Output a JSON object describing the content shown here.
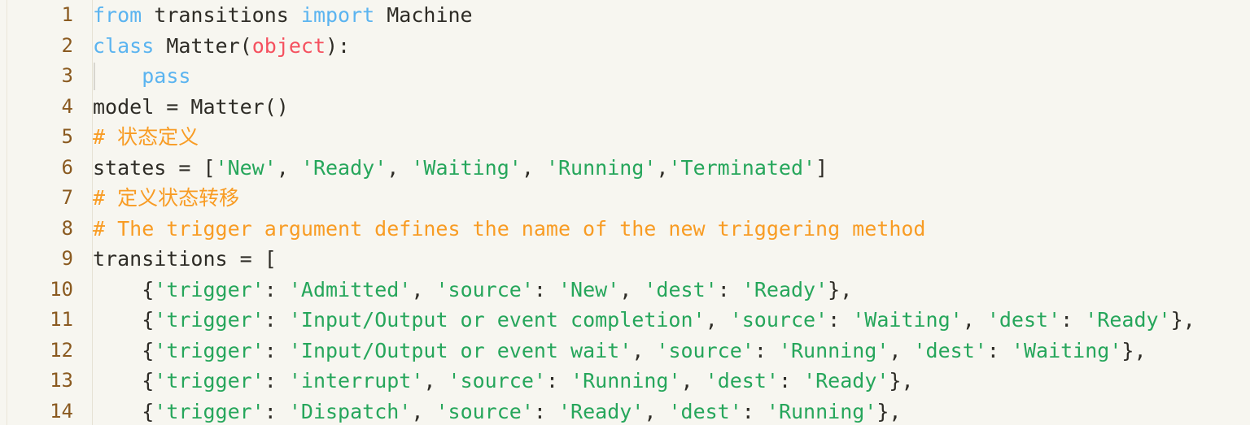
{
  "editor": {
    "language": "python",
    "theme": {
      "background": "#f7f6f0",
      "plain_text": "#2e2c26",
      "line_number": "#8a5a20",
      "keyword": "#5bb4f0",
      "class_name": "#f5515f",
      "string": "#26a65b",
      "comment": "#f89c24",
      "gutter_separator": "#e6e2d4",
      "indent_guide": "#d8d6cf"
    },
    "line_numbers": [
      "1",
      "2",
      "3",
      "4",
      "5",
      "6",
      "7",
      "8",
      "9",
      "10",
      "11",
      "12",
      "13",
      "14"
    ],
    "lines": [
      {
        "number": "1",
        "text": "from transitions import Machine",
        "tokens": [
          {
            "t": "from",
            "c": "kw"
          },
          {
            "t": " transitions ",
            "c": "pln"
          },
          {
            "t": "import",
            "c": "kw"
          },
          {
            "t": " Machine",
            "c": "pln"
          }
        ]
      },
      {
        "number": "2",
        "text": "class Matter(object):",
        "tokens": [
          {
            "t": "class",
            "c": "kw"
          },
          {
            "t": " Matter(",
            "c": "pln"
          },
          {
            "t": "object",
            "c": "cls"
          },
          {
            "t": "):",
            "c": "pln"
          }
        ]
      },
      {
        "number": "3",
        "text": "    pass",
        "indent_guide": true,
        "tokens": [
          {
            "t": "    ",
            "c": "pln"
          },
          {
            "t": "pass",
            "c": "kw"
          }
        ]
      },
      {
        "number": "4",
        "text": "model = Matter()",
        "tokens": [
          {
            "t": "model = Matter()",
            "c": "pln"
          }
        ]
      },
      {
        "number": "5",
        "text": "# 状态定义",
        "tokens": [
          {
            "t": "# 状态定义",
            "c": "com"
          }
        ]
      },
      {
        "number": "6",
        "text": "states = ['New', 'Ready', 'Waiting', 'Running','Terminated']",
        "tokens": [
          {
            "t": "states = [",
            "c": "pln"
          },
          {
            "t": "'New'",
            "c": "str"
          },
          {
            "t": ", ",
            "c": "pln"
          },
          {
            "t": "'Ready'",
            "c": "str"
          },
          {
            "t": ", ",
            "c": "pln"
          },
          {
            "t": "'Waiting'",
            "c": "str"
          },
          {
            "t": ", ",
            "c": "pln"
          },
          {
            "t": "'Running'",
            "c": "str"
          },
          {
            "t": ",",
            "c": "pln"
          },
          {
            "t": "'Terminated'",
            "c": "str"
          },
          {
            "t": "]",
            "c": "pln"
          }
        ]
      },
      {
        "number": "7",
        "text": "# 定义状态转移",
        "tokens": [
          {
            "t": "# 定义状态转移",
            "c": "com"
          }
        ]
      },
      {
        "number": "8",
        "text": "# The trigger argument defines the name of the new triggering method",
        "tokens": [
          {
            "t": "# The trigger argument defines the name of the new triggering method",
            "c": "com"
          }
        ]
      },
      {
        "number": "9",
        "text": "transitions = [",
        "tokens": [
          {
            "t": "transitions = [",
            "c": "pln"
          }
        ]
      },
      {
        "number": "10",
        "text": "    {'trigger': 'Admitted', 'source': 'New', 'dest': 'Ready'},",
        "tokens": [
          {
            "t": "    {",
            "c": "pln"
          },
          {
            "t": "'trigger'",
            "c": "str"
          },
          {
            "t": ": ",
            "c": "pln"
          },
          {
            "t": "'Admitted'",
            "c": "str"
          },
          {
            "t": ", ",
            "c": "pln"
          },
          {
            "t": "'source'",
            "c": "str"
          },
          {
            "t": ": ",
            "c": "pln"
          },
          {
            "t": "'New'",
            "c": "str"
          },
          {
            "t": ", ",
            "c": "pln"
          },
          {
            "t": "'dest'",
            "c": "str"
          },
          {
            "t": ": ",
            "c": "pln"
          },
          {
            "t": "'Ready'",
            "c": "str"
          },
          {
            "t": "},",
            "c": "pln"
          }
        ]
      },
      {
        "number": "11",
        "text": "    {'trigger': 'Input/Output or event completion', 'source': 'Waiting', 'dest': 'Ready'},",
        "tokens": [
          {
            "t": "    {",
            "c": "pln"
          },
          {
            "t": "'trigger'",
            "c": "str"
          },
          {
            "t": ": ",
            "c": "pln"
          },
          {
            "t": "'Input/Output or event completion'",
            "c": "str"
          },
          {
            "t": ", ",
            "c": "pln"
          },
          {
            "t": "'source'",
            "c": "str"
          },
          {
            "t": ": ",
            "c": "pln"
          },
          {
            "t": "'Waiting'",
            "c": "str"
          },
          {
            "t": ", ",
            "c": "pln"
          },
          {
            "t": "'dest'",
            "c": "str"
          },
          {
            "t": ": ",
            "c": "pln"
          },
          {
            "t": "'Ready'",
            "c": "str"
          },
          {
            "t": "},",
            "c": "pln"
          }
        ]
      },
      {
        "number": "12",
        "text": "    {'trigger': 'Input/Output or event wait', 'source': 'Running', 'dest': 'Waiting'},",
        "tokens": [
          {
            "t": "    {",
            "c": "pln"
          },
          {
            "t": "'trigger'",
            "c": "str"
          },
          {
            "t": ": ",
            "c": "pln"
          },
          {
            "t": "'Input/Output or event wait'",
            "c": "str"
          },
          {
            "t": ", ",
            "c": "pln"
          },
          {
            "t": "'source'",
            "c": "str"
          },
          {
            "t": ": ",
            "c": "pln"
          },
          {
            "t": "'Running'",
            "c": "str"
          },
          {
            "t": ", ",
            "c": "pln"
          },
          {
            "t": "'dest'",
            "c": "str"
          },
          {
            "t": ": ",
            "c": "pln"
          },
          {
            "t": "'Waiting'",
            "c": "str"
          },
          {
            "t": "},",
            "c": "pln"
          }
        ]
      },
      {
        "number": "13",
        "text": "    {'trigger': 'interrupt', 'source': 'Running', 'dest': 'Ready'},",
        "tokens": [
          {
            "t": "    {",
            "c": "pln"
          },
          {
            "t": "'trigger'",
            "c": "str"
          },
          {
            "t": ": ",
            "c": "pln"
          },
          {
            "t": "'interrupt'",
            "c": "str"
          },
          {
            "t": ", ",
            "c": "pln"
          },
          {
            "t": "'source'",
            "c": "str"
          },
          {
            "t": ": ",
            "c": "pln"
          },
          {
            "t": "'Running'",
            "c": "str"
          },
          {
            "t": ", ",
            "c": "pln"
          },
          {
            "t": "'dest'",
            "c": "str"
          },
          {
            "t": ": ",
            "c": "pln"
          },
          {
            "t": "'Ready'",
            "c": "str"
          },
          {
            "t": "},",
            "c": "pln"
          }
        ]
      },
      {
        "number": "14",
        "text": "    {'trigger': 'Dispatch', 'source': 'Ready', 'dest': 'Running'},",
        "tokens": [
          {
            "t": "    {",
            "c": "pln"
          },
          {
            "t": "'trigger'",
            "c": "str"
          },
          {
            "t": ": ",
            "c": "pln"
          },
          {
            "t": "'Dispatch'",
            "c": "str"
          },
          {
            "t": ", ",
            "c": "pln"
          },
          {
            "t": "'source'",
            "c": "str"
          },
          {
            "t": ": ",
            "c": "pln"
          },
          {
            "t": "'Ready'",
            "c": "str"
          },
          {
            "t": ", ",
            "c": "pln"
          },
          {
            "t": "'dest'",
            "c": "str"
          },
          {
            "t": ": ",
            "c": "pln"
          },
          {
            "t": "'Running'",
            "c": "str"
          },
          {
            "t": "},",
            "c": "pln"
          }
        ]
      }
    ]
  }
}
